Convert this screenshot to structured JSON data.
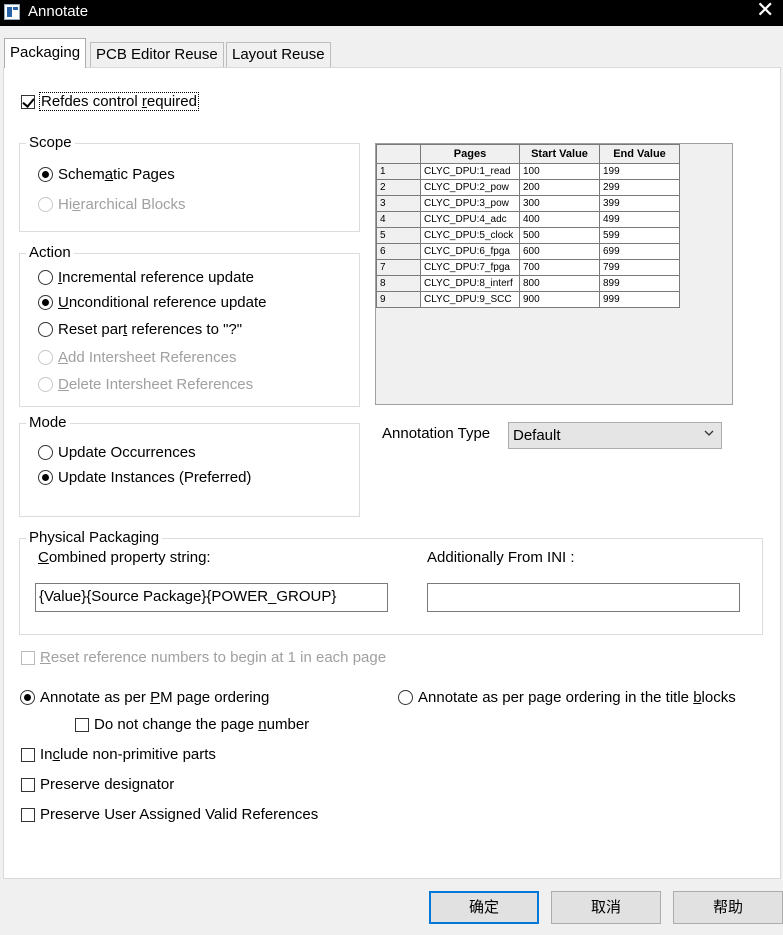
{
  "window": {
    "title": "Annotate",
    "close_glyph": "✕"
  },
  "tabs": [
    {
      "label": "Packaging"
    },
    {
      "label": "PCB Editor Reuse"
    },
    {
      "label": "Layout Reuse"
    }
  ],
  "refdes": {
    "label": "Refdes control required",
    "checked": true
  },
  "scope": {
    "title": "Scope",
    "options": [
      {
        "label": "Schematic Pages",
        "checked": true,
        "disabled": false
      },
      {
        "label": "Hierarchical Blocks",
        "checked": false,
        "disabled": true
      }
    ]
  },
  "action": {
    "title": "Action",
    "options": [
      {
        "label": "Incremental reference update",
        "checked": false,
        "disabled": false
      },
      {
        "label": "Unconditional reference update",
        "checked": true,
        "disabled": false
      },
      {
        "label": "Reset part references to \"?\"",
        "checked": false,
        "disabled": false
      },
      {
        "label": "Add Intersheet References",
        "checked": false,
        "disabled": true
      },
      {
        "label": "Delete Intersheet References",
        "checked": false,
        "disabled": true
      }
    ]
  },
  "mode": {
    "title": "Mode",
    "options": [
      {
        "label": "Update Occurrences",
        "checked": false
      },
      {
        "label": "Update Instances (Preferred)",
        "checked": true
      }
    ]
  },
  "pages_grid": {
    "headers": [
      "",
      "Pages",
      "Start Value",
      "End Value"
    ],
    "rows": [
      [
        "1",
        "CLYC_DPU:1_read",
        "100",
        "199"
      ],
      [
        "2",
        "CLYC_DPU:2_pow",
        "200",
        "299"
      ],
      [
        "3",
        "CLYC_DPU:3_pow",
        "300",
        "399"
      ],
      [
        "4",
        "CLYC_DPU:4_adc",
        "400",
        "499"
      ],
      [
        "5",
        "CLYC_DPU:5_clock",
        "500",
        "599"
      ],
      [
        "6",
        "CLYC_DPU:6_fpga",
        "600",
        "699"
      ],
      [
        "7",
        "CLYC_DPU:7_fpga",
        "700",
        "799"
      ],
      [
        "8",
        "CLYC_DPU:8_interf",
        "800",
        "899"
      ],
      [
        "9",
        "CLYC_DPU:9_SCC",
        "900",
        "999"
      ]
    ]
  },
  "annotation_type": {
    "label": "Annotation Type",
    "value": "Default",
    "icon": "chevron-down-icon"
  },
  "physical_packaging": {
    "title": "Physical Packaging",
    "combined_label": "Combined property string:",
    "combined_value": "{Value}{Source Package}{POWER_GROUP}",
    "ini_label": "Additionally From INI :",
    "ini_value": ""
  },
  "options": {
    "reset_each_page": {
      "label": "Reset reference numbers to begin at 1 in each page",
      "checked": false,
      "disabled": true
    },
    "annotate_pm": {
      "label": "Annotate as per PM page ordering",
      "checked": true
    },
    "annotate_title": {
      "label": "Annotate as per page ordering in the title blocks",
      "checked": false
    },
    "no_change_page": {
      "label": "Do not change the page number",
      "checked": false
    },
    "include_non_primitive": {
      "label": "Include non-primitive parts",
      "checked": false
    },
    "preserve_designator": {
      "label": "Preserve designator",
      "checked": false
    },
    "preserve_user_refs": {
      "label": "Preserve User Assigned Valid References",
      "checked": false
    }
  },
  "buttons": {
    "ok": "确定",
    "cancel": "取消",
    "help": "帮助"
  }
}
